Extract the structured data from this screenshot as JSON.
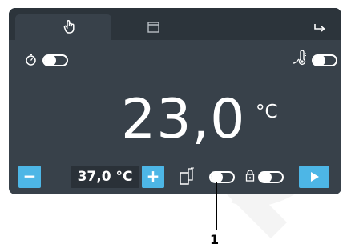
{
  "colors": {
    "screen_bg": "#38414a",
    "tabbar_bg": "#2c343b",
    "accent": "#4db6e6",
    "setpoint_bg": "#2a3138",
    "text": "#ffffff",
    "watermark": "#f4f4f4"
  },
  "tabs": [
    {
      "icon": "hand-pointer-icon",
      "active": true
    },
    {
      "icon": "calendar-icon",
      "active": false
    },
    {
      "icon": "return-arrow-icon",
      "active": false
    }
  ],
  "controls": {
    "timer_toggle": {
      "icon": "timer-icon",
      "on": false
    },
    "probe_toggle": {
      "icon": "thermometer-probe-icon",
      "on": false
    },
    "door_toggle": {
      "icon": "door-icon",
      "on": false
    },
    "lock_toggle": {
      "icon": "lock-icon",
      "on": false
    }
  },
  "display": {
    "temperature_value": "23,0",
    "temperature_unit": "°C"
  },
  "bottom_bar": {
    "minus_label": "−",
    "setpoint_value": "37,0 °C",
    "plus_label": "+",
    "play_icon": "play-icon"
  },
  "callout": {
    "label": "1"
  }
}
